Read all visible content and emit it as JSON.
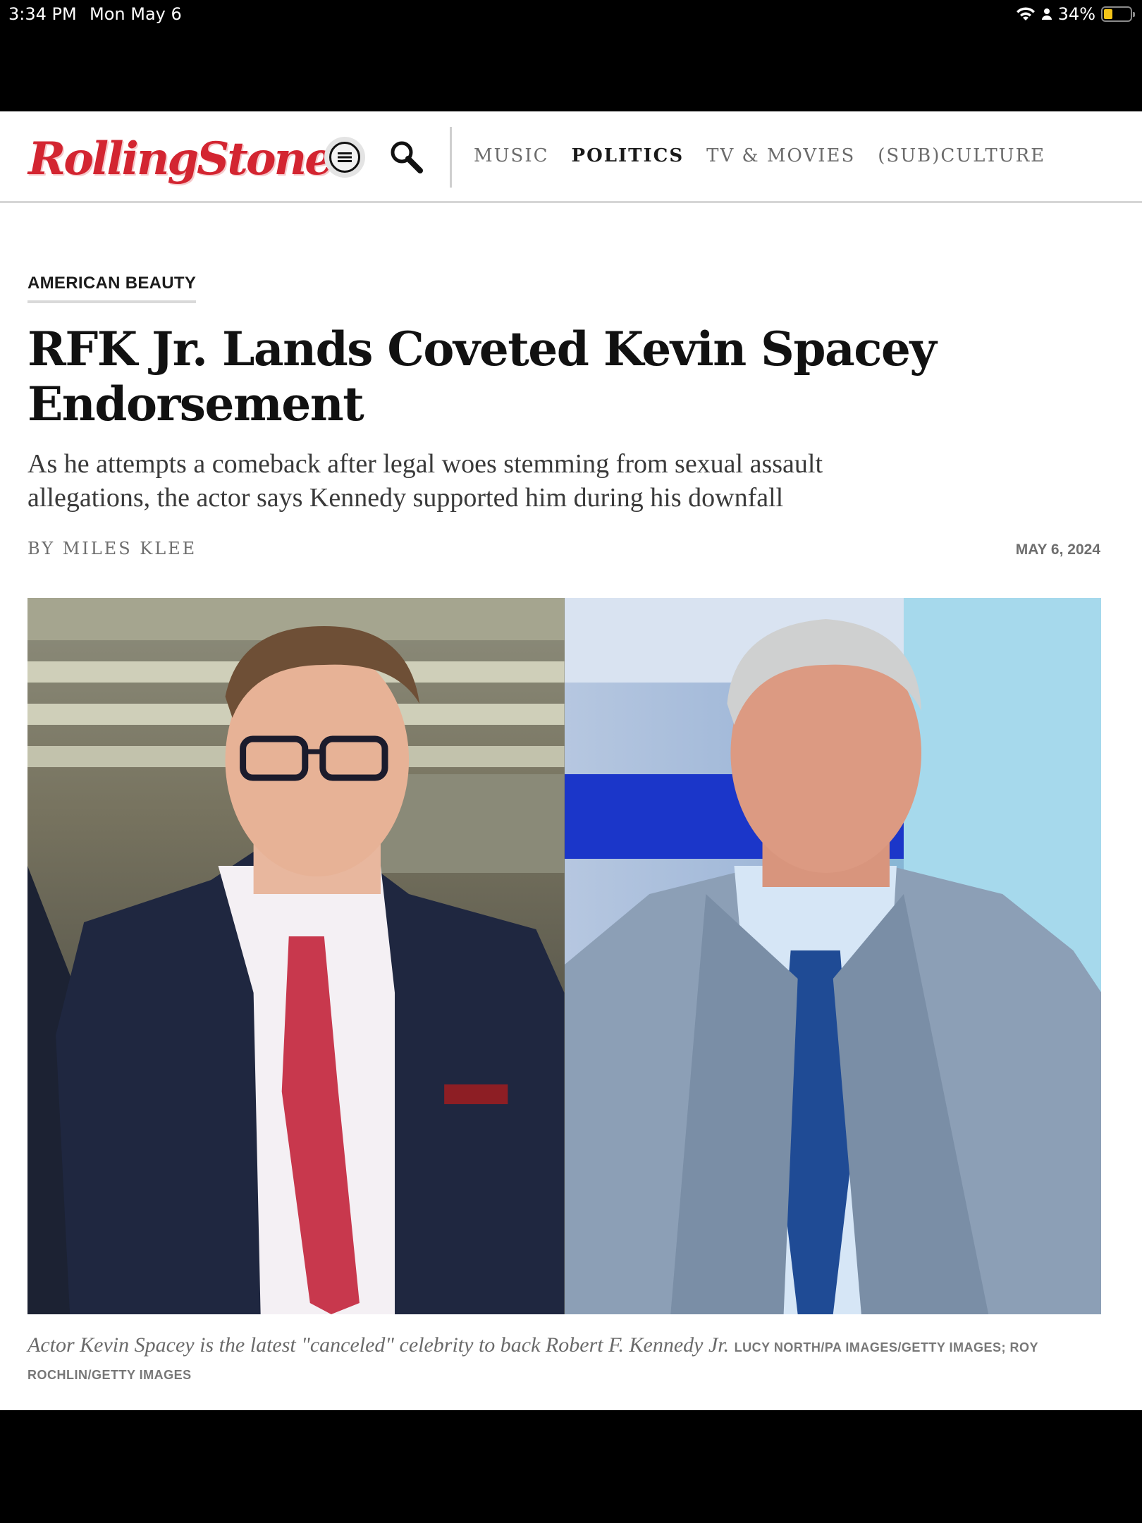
{
  "status_bar": {
    "time": "3:34 PM",
    "date": "Mon May 6",
    "battery": "34%",
    "battery_level": 0.34
  },
  "header": {
    "logo": "RollingStone",
    "nav": [
      {
        "label": "MUSIC",
        "active": false
      },
      {
        "label": "POLITICS",
        "active": true
      },
      {
        "label": "TV & MOVIES",
        "active": false
      },
      {
        "label": "(SUB)CULTURE",
        "active": false
      }
    ]
  },
  "article": {
    "kicker": "AMERICAN BEAUTY",
    "headline": "RFK Jr. Lands Coveted Kevin Spacey Endorsement",
    "dek": "As he attempts a comeback after legal woes stemming from sexual assault allegations, the actor says Kennedy supported him during his downfall",
    "byline": "BY MILES KLEE",
    "date": "MAY 6, 2024",
    "caption": "Actor Kevin Spacey is the latest \"canceled\" celebrity to back Robert F. Kennedy Jr.",
    "credit": "LUCY NORTH/PA IMAGES/GETTY IMAGES; ROY ROCHLIN/GETTY IMAGES"
  },
  "colors": {
    "brand_red": "#d32531",
    "text_dark": "#111111",
    "text_muted": "#6e6e6e"
  },
  "icons": {
    "menu": "menu-icon",
    "search": "search-icon",
    "wifi": "wifi-icon",
    "person": "person-icon",
    "battery": "battery-icon"
  }
}
